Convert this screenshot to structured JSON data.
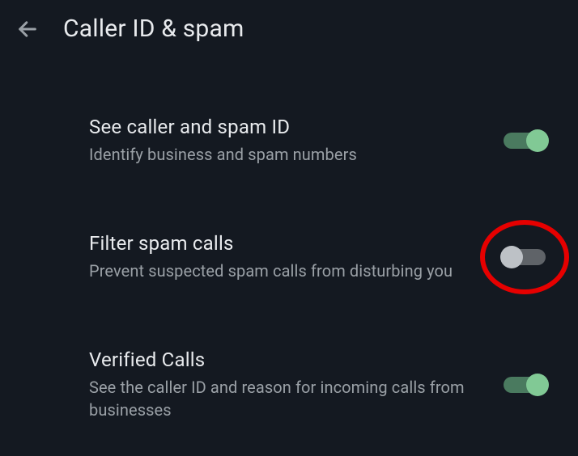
{
  "header": {
    "title": "Caller ID & spam"
  },
  "settings": {
    "see_caller_id": {
      "title": "See caller and spam ID",
      "description": "Identify business and spam numbers",
      "enabled": true
    },
    "filter_spam": {
      "title": "Filter spam calls",
      "description": "Prevent suspected spam calls from disturbing you",
      "enabled": false,
      "highlighted": true
    },
    "verified_calls": {
      "title": "Verified Calls",
      "description": "See the caller ID and reason for incoming calls from businesses",
      "enabled": true
    }
  }
}
